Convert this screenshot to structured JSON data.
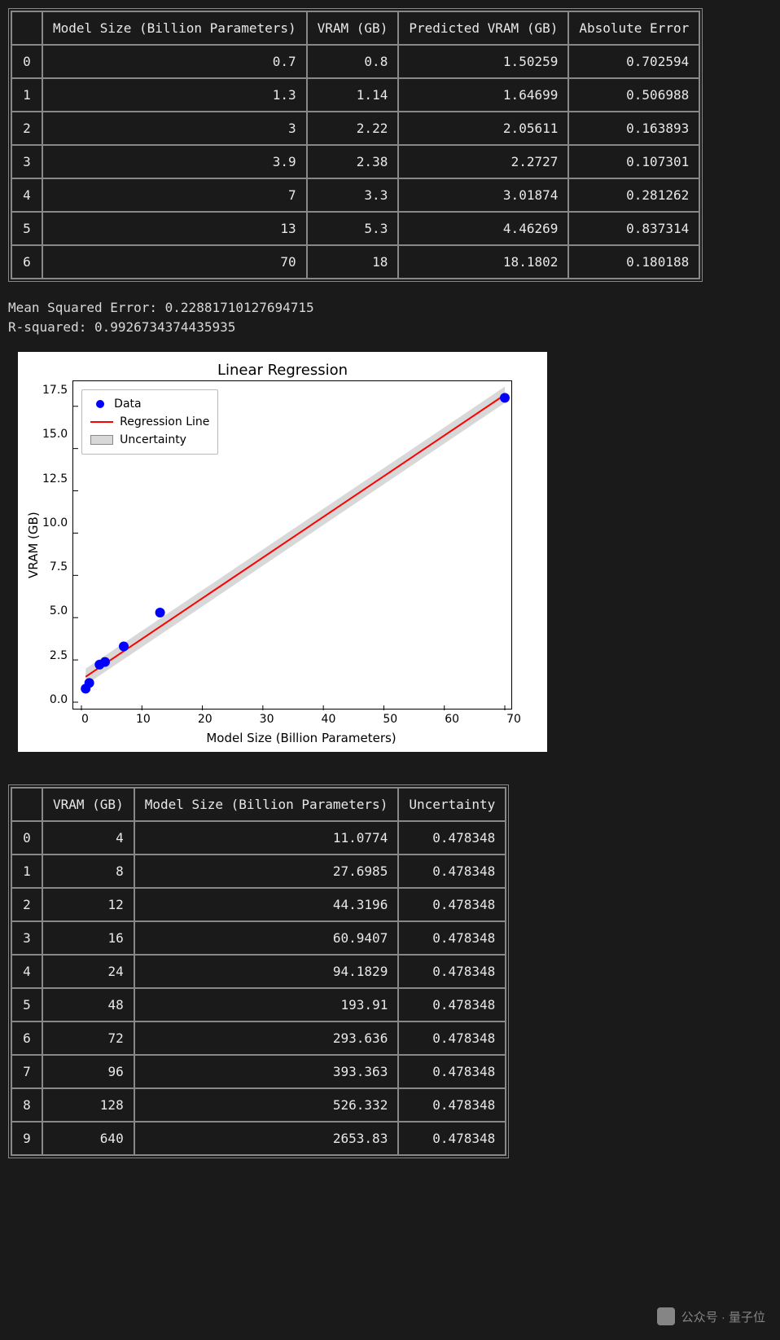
{
  "table1": {
    "headers": [
      "",
      "Model Size (Billion Parameters)",
      "VRAM (GB)",
      "Predicted VRAM (GB)",
      "Absolute Error"
    ],
    "rows": [
      [
        "0",
        "0.7",
        "0.8",
        "1.50259",
        "0.702594"
      ],
      [
        "1",
        "1.3",
        "1.14",
        "1.64699",
        "0.506988"
      ],
      [
        "2",
        "3",
        "2.22",
        "2.05611",
        "0.163893"
      ],
      [
        "3",
        "3.9",
        "2.38",
        "2.2727",
        "0.107301"
      ],
      [
        "4",
        "7",
        "3.3",
        "3.01874",
        "0.281262"
      ],
      [
        "5",
        "13",
        "5.3",
        "4.46269",
        "0.837314"
      ],
      [
        "6",
        "70",
        "18",
        "18.1802",
        "0.180188"
      ]
    ]
  },
  "metrics": {
    "mse_label": "Mean Squared Error: 0.22881710127694715",
    "r2_label": "R-squared: 0.9926734374435935"
  },
  "chart_data": {
    "type": "scatter+line",
    "title": "Linear Regression",
    "xlabel": "Model Size (Billion Parameters)",
    "ylabel": "VRAM (GB)",
    "xlim": [
      0,
      70
    ],
    "ylim": [
      0,
      18.5
    ],
    "xticks": [
      0,
      10,
      20,
      30,
      40,
      50,
      60,
      70
    ],
    "yticks": [
      0.0,
      2.5,
      5.0,
      7.5,
      10.0,
      12.5,
      15.0,
      17.5
    ],
    "legend": [
      "Data",
      "Regression Line",
      "Uncertainty"
    ],
    "legend_position": "upper left",
    "series": [
      {
        "name": "Data",
        "kind": "scatter",
        "color": "#0000ff",
        "x": [
          0.7,
          1.3,
          3,
          3.9,
          7,
          13,
          70
        ],
        "y": [
          0.8,
          1.14,
          2.22,
          2.38,
          3.3,
          5.3,
          18
        ]
      },
      {
        "name": "Regression Line",
        "kind": "line",
        "color": "#ff0000",
        "x": [
          0.7,
          70
        ],
        "y": [
          1.50259,
          18.1802
        ]
      },
      {
        "name": "Uncertainty",
        "kind": "band",
        "color": "#d8d8d8",
        "x": [
          0.7,
          70
        ],
        "y_low": [
          1.02,
          17.7
        ],
        "y_high": [
          1.98,
          18.66
        ]
      }
    ]
  },
  "table2": {
    "headers": [
      "",
      "VRAM (GB)",
      "Model Size (Billion Parameters)",
      "Uncertainty"
    ],
    "rows": [
      [
        "0",
        "4",
        "11.0774",
        "0.478348"
      ],
      [
        "1",
        "8",
        "27.6985",
        "0.478348"
      ],
      [
        "2",
        "12",
        "44.3196",
        "0.478348"
      ],
      [
        "3",
        "16",
        "60.9407",
        "0.478348"
      ],
      [
        "4",
        "24",
        "94.1829",
        "0.478348"
      ],
      [
        "5",
        "48",
        "193.91",
        "0.478348"
      ],
      [
        "6",
        "72",
        "293.636",
        "0.478348"
      ],
      [
        "7",
        "96",
        "393.363",
        "0.478348"
      ],
      [
        "8",
        "128",
        "526.332",
        "0.478348"
      ],
      [
        "9",
        "640",
        "2653.83",
        "0.478348"
      ]
    ]
  },
  "watermark": {
    "text": "公众号 · 量子位"
  }
}
